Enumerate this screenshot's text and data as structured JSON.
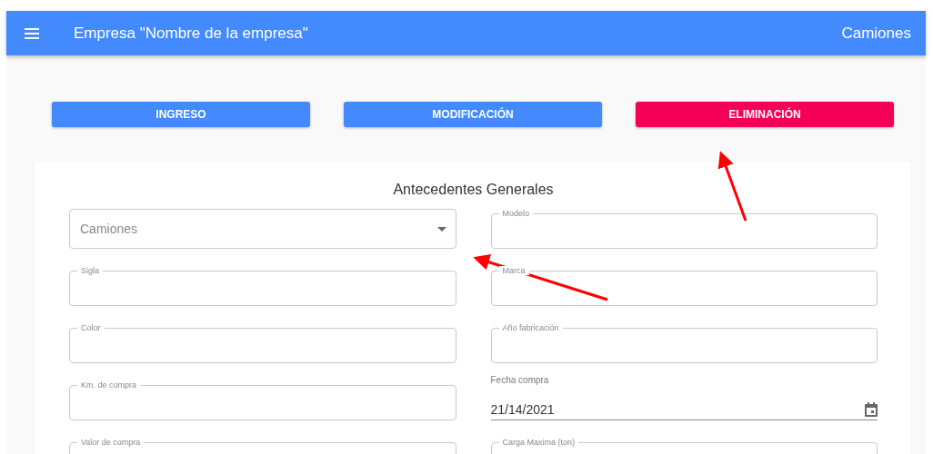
{
  "app_bar": {
    "title": "Empresa \"Nombre de la empresa\"",
    "section": "Camiones"
  },
  "action_buttons": [
    {
      "label": "INGRESO",
      "color": "#448aff"
    },
    {
      "label": "MODIFICACIÓN",
      "color": "#448aff"
    },
    {
      "label": "ELIMINACIÓN",
      "color": "#f50057"
    }
  ],
  "form": {
    "title": "Antecedentes Generales",
    "fields": [
      {
        "kind": "select",
        "placeholder": "Camiones"
      },
      {
        "kind": "outlined",
        "label": "Modelo"
      },
      {
        "kind": "outlined",
        "label": "Sigla"
      },
      {
        "kind": "outlined",
        "label": "Marca"
      },
      {
        "kind": "outlined",
        "label": "Color"
      },
      {
        "kind": "outlined",
        "label": "Año fabricación"
      },
      {
        "kind": "outlined",
        "label": "Km. de compra"
      },
      {
        "kind": "date",
        "label": "Fecha compra",
        "value": "21/14/2021"
      },
      {
        "kind": "outlined",
        "label": "Valor de compra"
      },
      {
        "kind": "outlined",
        "label": "Carga Maxima (ton)"
      }
    ]
  }
}
